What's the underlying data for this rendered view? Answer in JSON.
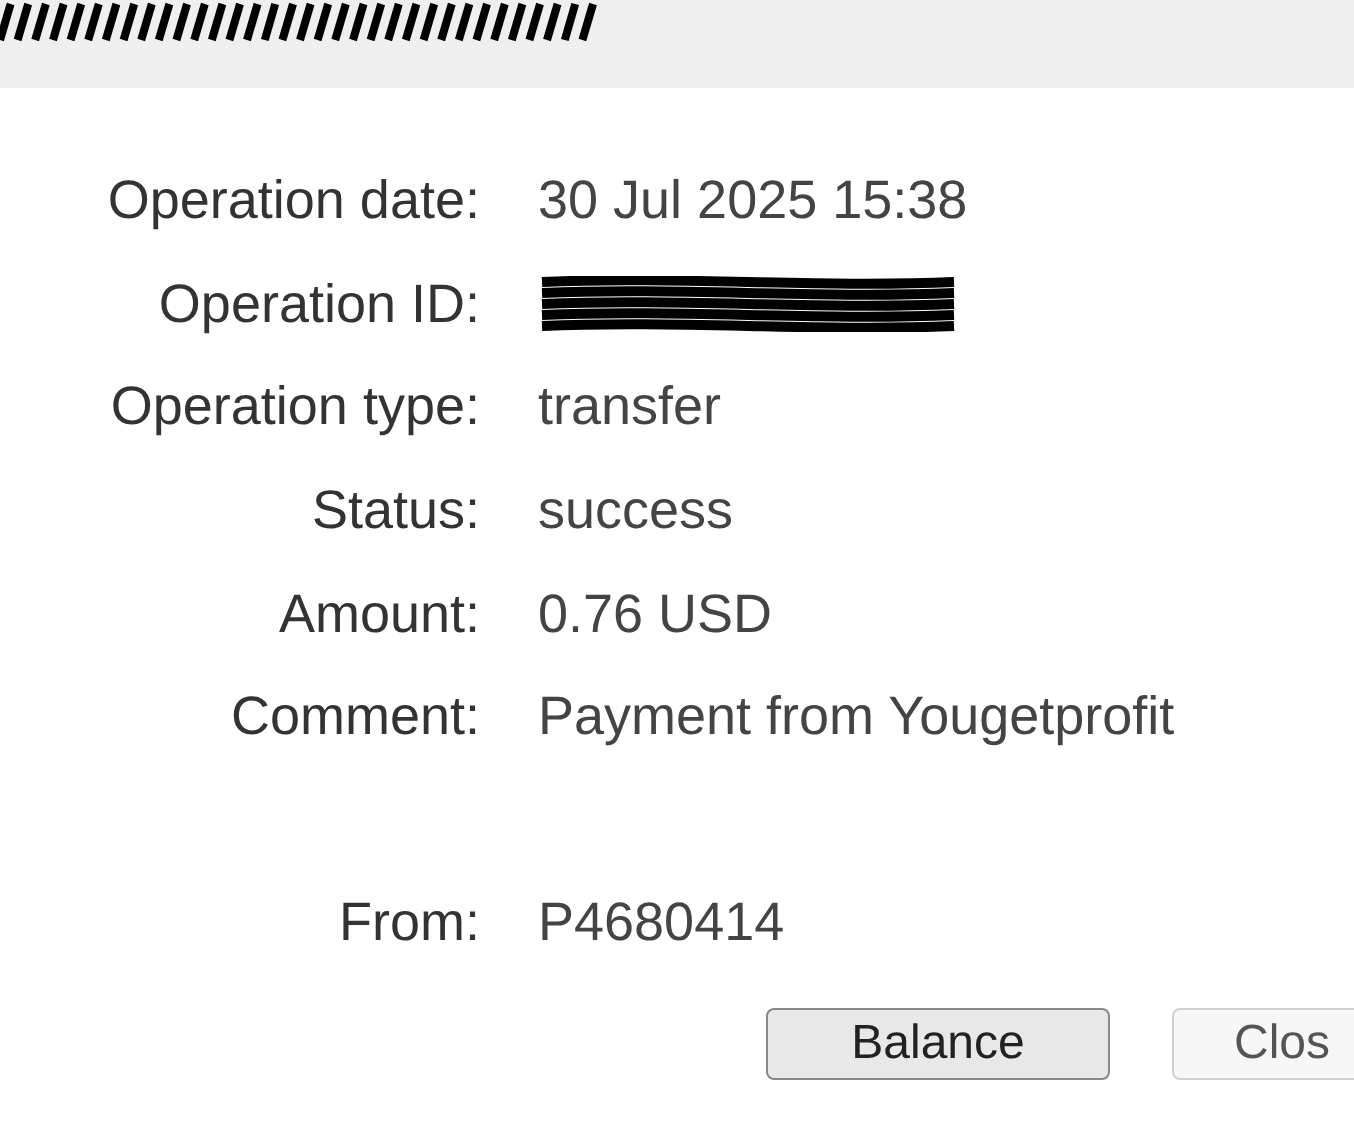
{
  "title_bar": {
    "redacted": true
  },
  "fields": [
    {
      "label": "Operation date:",
      "kind": "text",
      "value": "30 Jul 2025 15:38"
    },
    {
      "label": "Operation ID:",
      "kind": "redacted"
    },
    {
      "label": "Operation type:",
      "kind": "text",
      "value": "transfer"
    },
    {
      "label": "Status:",
      "kind": "text",
      "value": "success"
    },
    {
      "label": "Amount:",
      "kind": "text",
      "value": "0.76 USD"
    },
    {
      "label": "Comment:",
      "kind": "text",
      "value": "Payment from Yougetprofit"
    },
    {
      "kind": "spacer"
    },
    {
      "label": "From:",
      "kind": "text",
      "value": "P4680414"
    }
  ],
  "buttons": [
    {
      "label": "Balance",
      "kind": "primary"
    },
    {
      "label": "Clos",
      "kind": "secondary"
    }
  ]
}
